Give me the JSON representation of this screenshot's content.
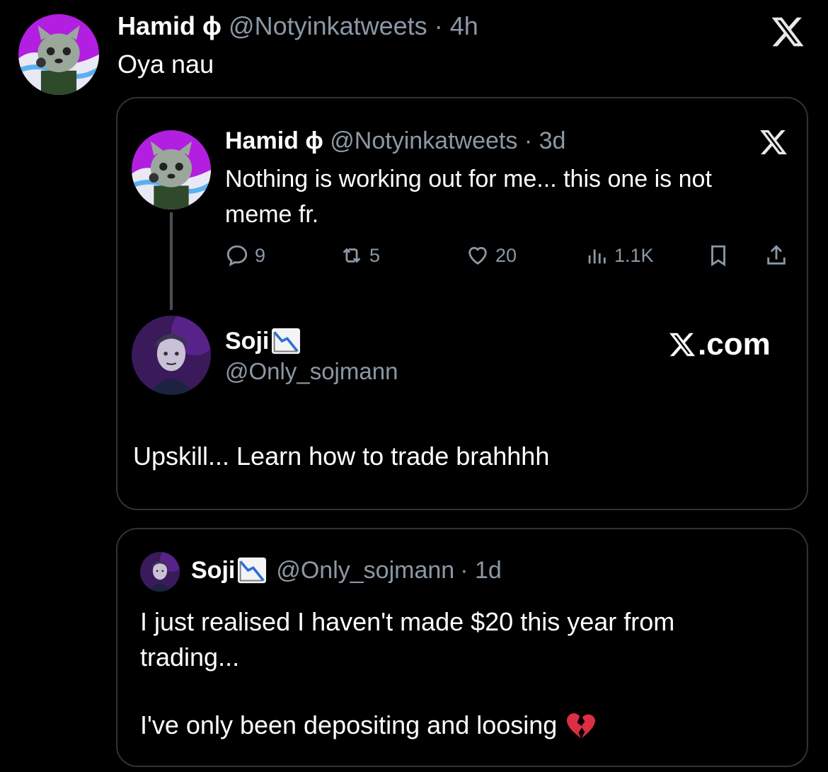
{
  "top_tweet": {
    "name": "Hamid ɸ",
    "handle": "@Notyinkatweets",
    "time": "· 4h",
    "text": "Oya nau",
    "avatar_icon": "raccoon-avatar-icon",
    "logo_icon": "x-logo-icon"
  },
  "quote1": {
    "name": "Hamid ɸ",
    "handle": "@Notyinkatweets",
    "time": "· 3d",
    "text": "Nothing is working out for me... this one is not meme fr.",
    "actions": {
      "replies": "9",
      "retweets": "5",
      "likes": "20",
      "views": "1.1K"
    },
    "reply": {
      "name": "Soji",
      "handle": "@Only_sojmann",
      "site": ".com",
      "text": "Upskill... Learn how to trade brahhhh"
    }
  },
  "quote2": {
    "name": "Soji",
    "handle": "@Only_sojmann",
    "time": "· 1d",
    "text1": "I just realised I haven't made $20 this year from trading...",
    "text2": "I've only been depositing and loosing"
  },
  "colors": {
    "background": "#000000",
    "text": "#e7e9ea",
    "muted": "#8b98a5",
    "border": "#2f3336",
    "avatar_purple": "#a020f0"
  }
}
